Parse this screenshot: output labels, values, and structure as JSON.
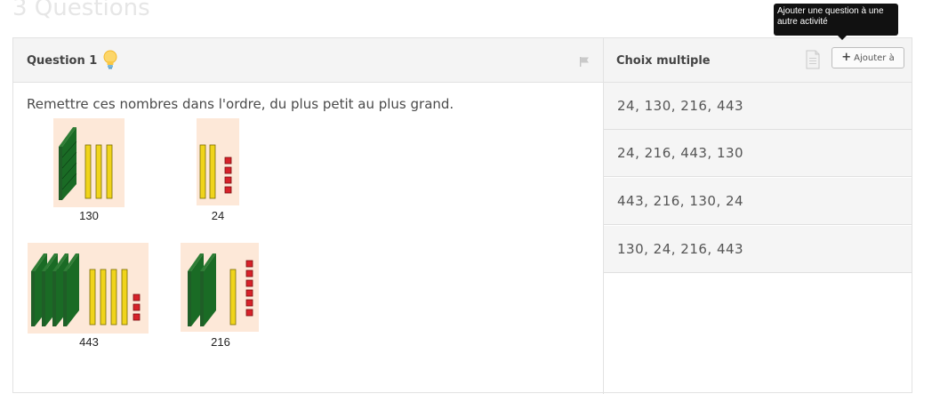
{
  "section": {
    "title": "3 Questions"
  },
  "tooltip": {
    "text": "Ajouter une question à une autre activité"
  },
  "question": {
    "label": "Question 1",
    "prompt": "Remettre ces nombres dans l'ordre, du plus petit au plus grand.",
    "items": [
      {
        "value": "130",
        "hundreds": 1,
        "tens": 3,
        "ones": 0
      },
      {
        "value": "24",
        "hundreds": 0,
        "tens": 2,
        "ones": 4
      },
      {
        "value": "443",
        "hundreds": 4,
        "tens": 4,
        "ones": 3
      },
      {
        "value": "216",
        "hundreds": 2,
        "tens": 1,
        "ones": 6
      }
    ]
  },
  "answers": {
    "title": "Choix multiple",
    "add_label": "Ajouter à",
    "choices": [
      "24,  130,  216,  443",
      "24,  216,  443,  130",
      "443,  216,  130,  24",
      "130,  24,  216,  443"
    ]
  },
  "icons": [
    "lightbulb-icon",
    "flag-icon",
    "document-icon",
    "plus-icon"
  ]
}
